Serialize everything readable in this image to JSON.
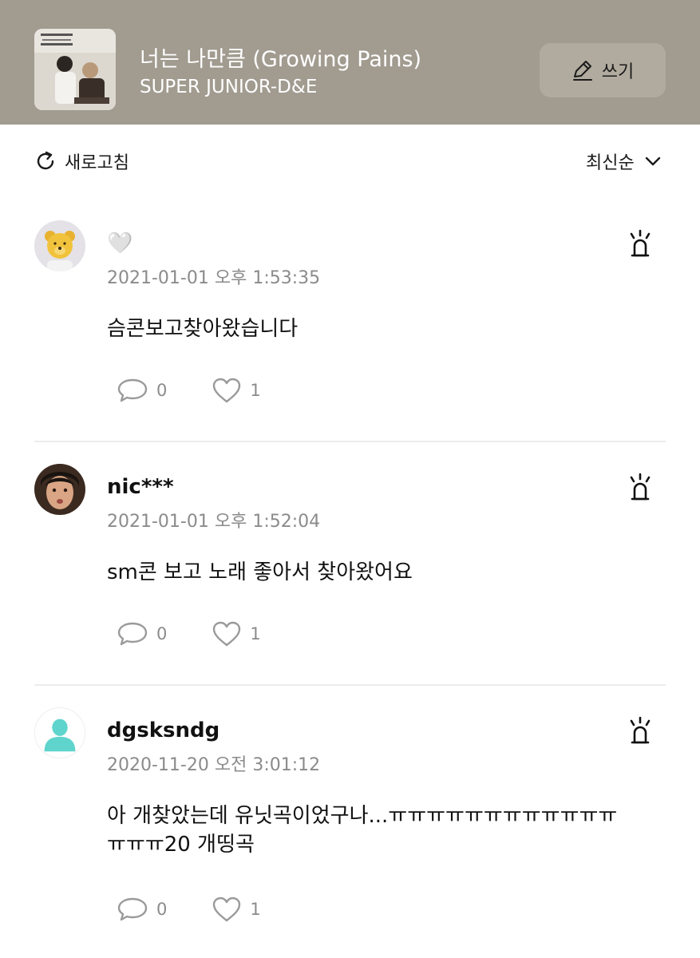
{
  "header": {
    "song_title": "너는 나만큼 (Growing Pains)",
    "artist": "SUPER JUNIOR-D&E",
    "album_cover_text": "SUPER JUNIOR-D&E · THE BEAT GOES ON",
    "write_label": "쓰기",
    "background_color": "#a19b90"
  },
  "toolbar": {
    "refresh_label": "새로고침",
    "sort_label": "최신순"
  },
  "comments": [
    {
      "username": "🤍",
      "timestamp": "2021-01-01 오후 1:53:35",
      "text": "슴콘보고찾아왔습니다",
      "reply_count": "0",
      "like_count": "1",
      "avatar": "yellow-bear-avatar"
    },
    {
      "username": "nic***",
      "timestamp": "2021-01-01 오후 1:52:04",
      "text": "sm콘 보고 노래 좋아서 찾아왔어요",
      "reply_count": "0",
      "like_count": "1",
      "avatar": "person-photo-avatar"
    },
    {
      "username": "dgsksndg",
      "timestamp": "2020-11-20 오전 3:01:12",
      "text": "아 개찾았는데 유닛곡이었구나...ㅠㅠㅠㅠㅠㅠㅠㅠㅠㅠㅠㅠㅠㅠㅠ20 개띵곡",
      "reply_count": "0",
      "like_count": "1",
      "avatar": "default-teal-avatar"
    }
  ],
  "colors": {
    "accent_teal": "#5fd4cc",
    "meta_gray": "#8b8b8b"
  }
}
